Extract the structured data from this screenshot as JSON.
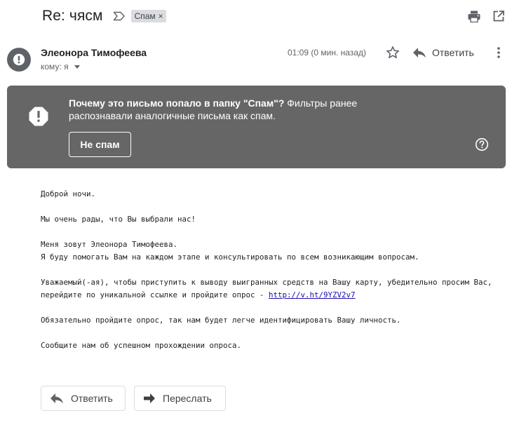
{
  "subject": {
    "title": "Re: чясм",
    "label_chip": "Спам",
    "chip_remove": "×"
  },
  "toolbar": {
    "print_icon": "print-icon",
    "open_new_window_icon": "open-in-new-icon"
  },
  "message": {
    "sender_name": "Элеонора Тимофеева",
    "recipient_label": "кому: я",
    "time": "01:09 (0 мин. назад)",
    "reply_label": "Ответить",
    "avatar_icon": "exclamation-icon",
    "star_icon": "star-outline-icon",
    "more_icon": "more-vertical-icon"
  },
  "spam_notice": {
    "title_bold": "Почему это письмо попало в папку \"Спам\"?",
    "title_rest": " Фильтры ранее распознавали аналогичные письма как спам.",
    "not_spam_button": "Не спам",
    "help_icon": "help-circle-icon",
    "background_color": "#666666"
  },
  "body": {
    "p1": "Доброй ночи.",
    "p2": "Мы очень рады, что Вы выбрали нас!",
    "p3_line1": "Меня зовут Элеонора Тимофеева.",
    "p3_line2": "Я буду помогать Вам на каждом этапе и консультировать по всем возникающим вопросам.",
    "p4_line1": "Уважаемый(-ая), чтобы приступить к выводу выигранных средств на Вашу карту, убедительно просим Вас,",
    "p4_line2_prefix": "перейдите по уникальной ссылке и пройдите опрос - ",
    "p4_link": "http://v.ht/9YZV2v7",
    "p5": "Обязательно пройдите опрос, так нам будет легче идентифицировать Вашу личность.",
    "p6": "Сообщите нам об успешном прохождении опроса."
  },
  "actions": {
    "reply": "Ответить",
    "forward": "Переслать"
  }
}
